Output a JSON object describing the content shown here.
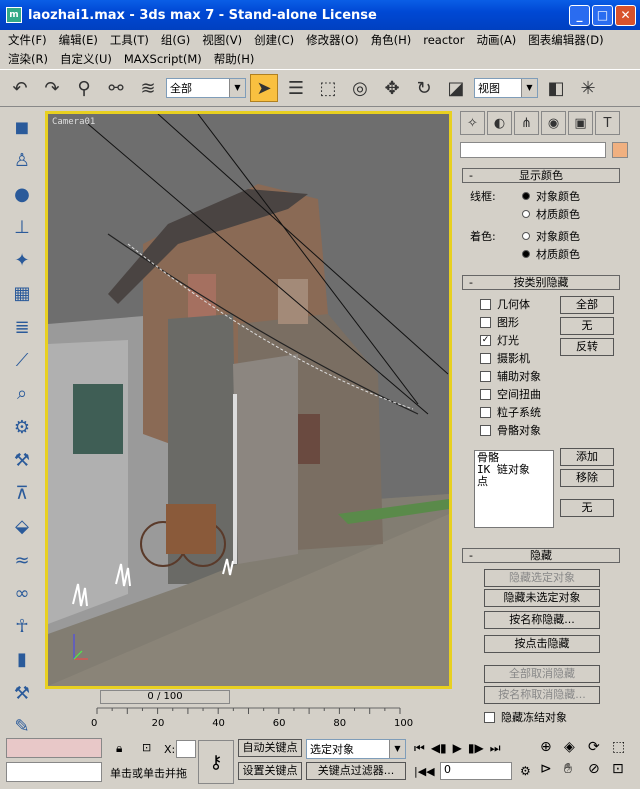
{
  "window": {
    "title": "laozhai1.max - 3ds max 7 - Stand-alone License"
  },
  "menu": {
    "row1": [
      "文件(F)",
      "编辑(E)",
      "工具(T)",
      "组(G)",
      "视图(V)",
      "创建(C)",
      "修改器(O)",
      "角色(H)",
      "reactor",
      "动画(A)",
      "图表编辑器(D)"
    ],
    "row2": [
      "渲染(R)",
      "自定义(U)",
      "MAXScript(M)",
      "帮助(H)"
    ]
  },
  "toolbar": {
    "filter_value": "全部",
    "view_value": "视图"
  },
  "viewport": {
    "label": "Camera01"
  },
  "panel": {
    "display_color": {
      "title": "显示颜色",
      "wire_label": "线框:",
      "shade_label": "着色:",
      "object_color": "对象颜色",
      "material_color": "材质颜色"
    },
    "hide_by_category": {
      "title": "按类别隐藏",
      "items": [
        {
          "label": "几何体",
          "checked": false
        },
        {
          "label": "图形",
          "checked": false
        },
        {
          "label": "灯光",
          "checked": true
        },
        {
          "label": "摄影机",
          "checked": false
        },
        {
          "label": "辅助对象",
          "checked": false
        },
        {
          "label": "空间扭曲",
          "checked": false
        },
        {
          "label": "粒子系统",
          "checked": false
        },
        {
          "label": "骨骼对象",
          "checked": false
        }
      ],
      "btn_all": "全部",
      "btn_none": "无",
      "btn_invert": "反转",
      "list": [
        "骨骼",
        "IK 链对象",
        "点"
      ],
      "btn_add": "添加",
      "btn_remove": "移除",
      "btn_none2": "无"
    },
    "hide": {
      "title": "隐藏",
      "hide_selected": "隐藏选定对象",
      "hide_unselected": "隐藏未选定对象",
      "hide_by_name": "按名称隐藏...",
      "hide_by_hit": "按点击隐藏",
      "unhide_all": "全部取消隐藏",
      "unhide_by_name": "按名称取消隐藏...",
      "hide_frozen": "隐藏冻结对象"
    }
  },
  "timeline": {
    "frame": "0 / 100",
    "ticks": [
      "0",
      "20",
      "40",
      "60",
      "80",
      "100"
    ]
  },
  "status": {
    "x_label": "X:",
    "auto_key": "自动关键点",
    "set_key": "设置关键点",
    "selected_object": "选定对象",
    "key_filters": "关键点过滤器...",
    "frame_value": "0",
    "prompt": "单击或单击并拖"
  },
  "colors": {
    "accent": "#0a5ee6",
    "viewport_border": "#e8d020"
  }
}
